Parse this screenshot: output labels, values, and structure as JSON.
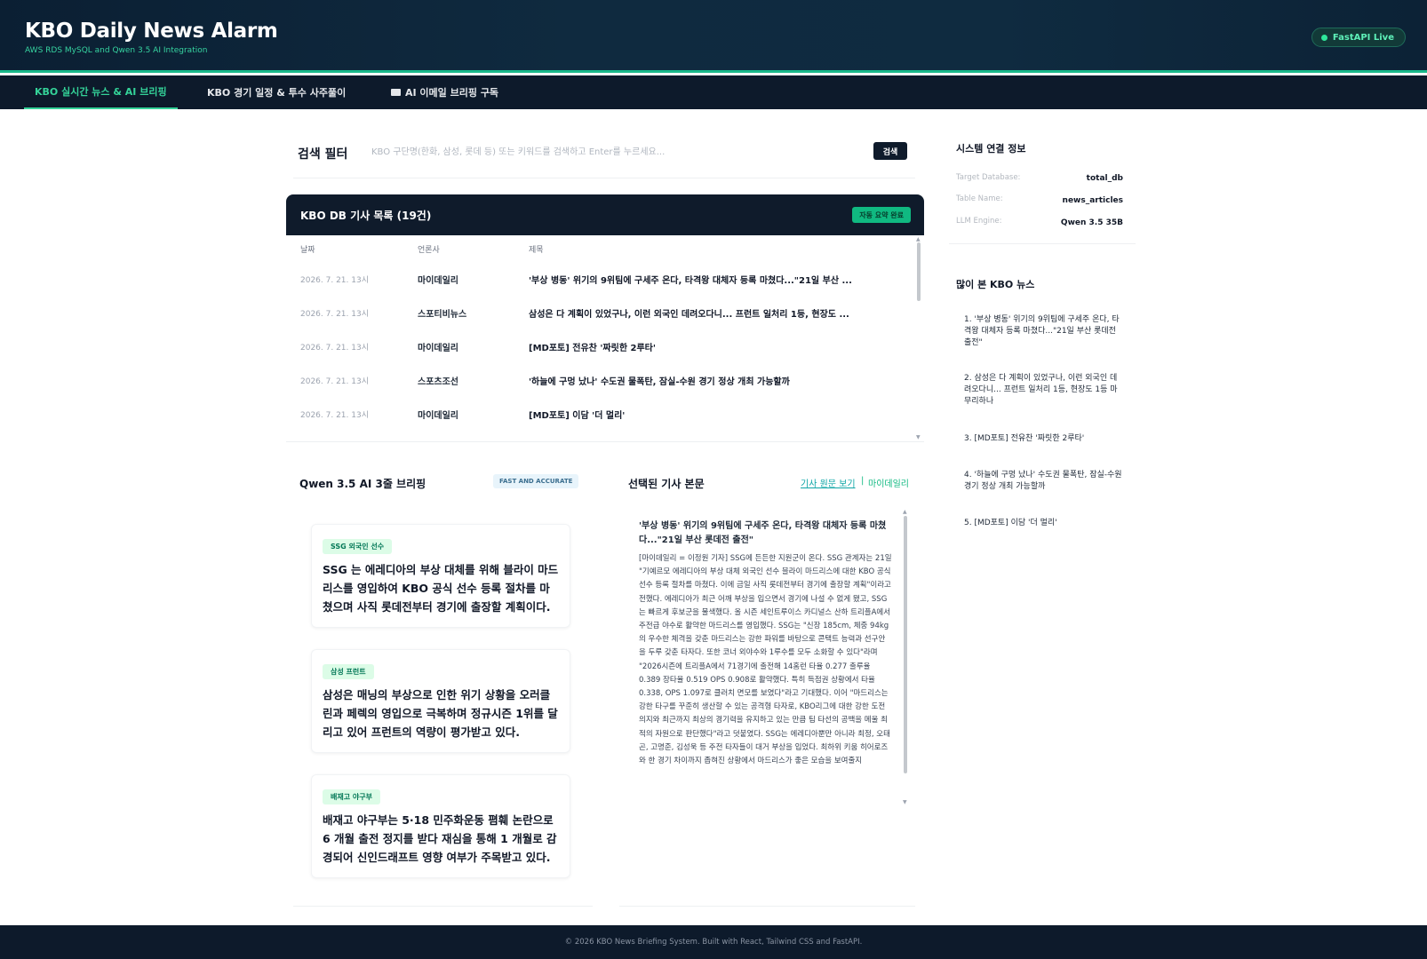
{
  "header": {
    "title": "KBO Daily News Alarm",
    "subtitle": "AWS RDS MySQL and Qwen 3.5 AI Integration",
    "status": "FastAPI Live",
    "accent": "#34d399"
  },
  "nav": {
    "tabs": [
      {
        "label": "KBO 실시간 뉴스 & AI 브리핑"
      },
      {
        "label": "KBO 경기 일정 & 투수 사주풀이"
      },
      {
        "label": "AI 이메일 브리핑 구독"
      }
    ]
  },
  "search": {
    "title": "검색 필터",
    "placeholder": "KBO 구단명(한화, 삼성, 롯데 등) 또는 키워드를 검색하고 Enter를 누르세요...",
    "button": "검색"
  },
  "articles": {
    "title": "KBO DB 기사 목록 (19건)",
    "badge": "자동 요약 완료",
    "columns": [
      "날짜",
      "언론사",
      "제목"
    ],
    "rows": [
      {
        "date": "2026. 7. 21. 13시",
        "press": "마이데일리",
        "title": "'부상 병동' 위기의 9위팀에 구세주 온다, 타격왕 대체자 등록 마쳤다...\"21일 부산 ..."
      },
      {
        "date": "2026. 7. 21. 13시",
        "press": "스포티비뉴스",
        "title": "삼성은 다 계획이 있었구나, 이런 외국인 데려오다니... 프런트 일처리 1등, 현장도 ..."
      },
      {
        "date": "2026. 7. 21. 13시",
        "press": "마이데일리",
        "title": "[MD포토] 전유찬 '짜릿한 2루타'"
      },
      {
        "date": "2026. 7. 21. 13시",
        "press": "스포츠조선",
        "title": "'하늘에 구멍 났나' 수도권 물폭탄, 잠실-수원 경기 정상 개최 가능할까"
      },
      {
        "date": "2026. 7. 21. 13시",
        "press": "마이데일리",
        "title": "[MD포토] 이담 '더 멀리'"
      }
    ]
  },
  "briefing": {
    "title": "Qwen 3.5 AI 3줄 브리핑",
    "badge": "FAST AND ACCURATE",
    "items": [
      {
        "tag": "SSG 외국인 선수",
        "text": "SSG 는 에레디아의 부상 대체를 위해 블라이 마드리스를 영입하여 KBO 공식 선수 등록 절차를 마쳤으며 사직 롯데전부터 경기에 출장할 계획이다."
      },
      {
        "tag": "삼성 프런트",
        "text": "삼성은 매닝의 부상으로 인한 위기 상황을 오러클린과 페렉의 영입으로 극복하며 정규시즌 1위를 달리고 있어 프런트의 역량이 평가받고 있다."
      },
      {
        "tag": "배재고 야구부",
        "text": "배재고 야구부는 5·18 민주화운동 폄훼 논란으로 6 개월 출전 정지를 받다 재심을 통해 1 개월로 감경되어 신인드래프트 영향 여부가 주목받고 있다."
      }
    ]
  },
  "selected": {
    "title": "선택된 기사 본문",
    "link": "기사 원문 보기",
    "separator": "|",
    "press": "마이데일리",
    "headline": "'부상 병동' 위기의 9위팀에 구세주 온다, 타격왕 대체자 등록 마쳤다...\"21일 부산 롯데전 출전\"",
    "body": "[마이데일리 = 이정원 기자] SSG에 든든한 지원군이 온다. SSG 관계자는 21일 \"기예르모 에레디아의 부상 대체 외국인 선수 블라이 마드리스에 대한 KBO 공식 선수 등록 절차를 마쳤다. 이에 금일 사직 롯데전부터 경기에 출장할 계획\"이라고 전했다. 에레디아가 최근 어깨 부상을 입으면서 경기에 나설 수 없게 됐고, SSG는 빠르게 후보군을 물색했다. 올 시즌 세인트루이스 카디널스 산하 트리플A에서 주전급 야수로 활약한 마드리스를 영입했다. SSG는 \"신장 185cm, 체중 94kg의 우수한 체격을 갖춘 마드리스는 강한 파워를 바탕으로 콘택트 능력과 선구안을 두루 갖춘 타자다. 또한 코너 외야수와 1루수를 모두 소화할 수 있다\"라며 \"2026시즌에 트리플A에서 71경기에 출전해 14홈런 타율 0.277 출루율 0.389 장타율 0.519 OPS 0.908로 활약했다. 특히 득점권 상황에서 타율 0.338, OPS 1.097로 클러치 면모를 보였다\"라고 기대했다. 이어 \"마드리스는 강한 타구를 꾸준히 생산할 수 있는 공격형 타자로, KBO리그에 대한 강한 도전 의지와 최근까지 최상의 경기력을 유지하고 있는 만큼 팀 타선의 공백을 메울 최적의 자원으로 판단했다\"라고 덧붙였다. SSG는 에레디아뿐만 아니라 최정, 오태곤, 고명준, 김성욱 등 주전 타자들이 대거 부상을 입었다. 최하위 키움 히어로즈와 한 경기 차이까지 좁혀진 상황에서 마드리스가 좋은 모습을 보여줄지"
  },
  "system": {
    "title": "시스템 연결 정보",
    "items": [
      {
        "label": "Target Database:",
        "value": "total_db"
      },
      {
        "label": "Table Name:",
        "value": "news_articles"
      },
      {
        "label": "LLM Engine:",
        "value": "Qwen 3.5 35B"
      }
    ]
  },
  "popular": {
    "title": "많이 본 KBO 뉴스",
    "items": [
      "1. '부상 병동' 위기의 9위팀에 구세주 온다, 타격왕 대체자 등록 마쳤다...\"21일 부산 롯데전 출전\"",
      "2. 삼성은 다 계획이 있었구나, 이런 외국인 데려오다니... 프런트 일처리 1등, 현장도 1등 마무리하나",
      "3. [MD포토] 전유찬 '짜릿한 2루타'",
      "4. '하늘에 구멍 났나' 수도권 물폭탄, 잠실-수원 경기 정상 개최 가능할까",
      "5. [MD포토] 이담 '더 멀리'"
    ]
  },
  "footer": {
    "text": "© 2026 KBO News Briefing System. Built with React, Tailwind CSS and FastAPI."
  }
}
